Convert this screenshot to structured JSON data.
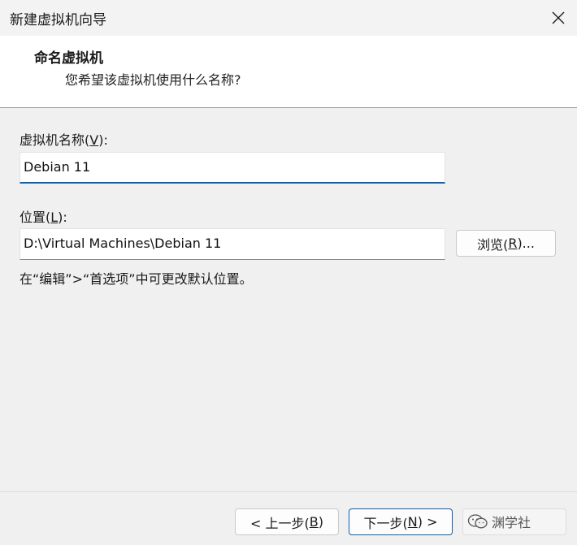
{
  "window": {
    "title": "新建虚拟机向导",
    "close_icon": "close-icon"
  },
  "header": {
    "heading": "命名虚拟机",
    "subheading": "您希望该虚拟机使用什么名称?"
  },
  "name_field": {
    "label_prefix": "虚拟机名称(",
    "label_key": "V",
    "label_suffix": "):",
    "value": "Debian 11"
  },
  "location_field": {
    "label_prefix": "位置(",
    "label_key": "L",
    "label_suffix": "):",
    "value": "D:\\Virtual Machines\\Debian 11"
  },
  "browse_button": {
    "label_prefix": "浏览(",
    "label_key": "R",
    "label_suffix": ")..."
  },
  "hint": "在“编辑”>“首选项”中可更改默认位置。",
  "footer": {
    "back": {
      "prefix": "< 上一步(",
      "key": "B",
      "suffix": ")"
    },
    "next": {
      "prefix": "下一步(",
      "key": "N",
      "suffix": ") >"
    },
    "watermark": "渊学社"
  },
  "colors": {
    "accent": "#0a5fb0",
    "background": "#f0f0f0",
    "header_bg": "#ffffff"
  }
}
